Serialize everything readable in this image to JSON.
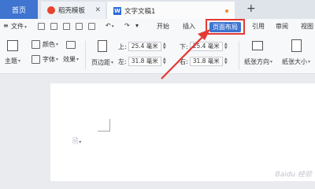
{
  "tabs": {
    "home": "首页",
    "templates": "稻壳模板",
    "document": "文字文稿1",
    "close_glyph": "✕",
    "new_tab": "+"
  },
  "menubar": {
    "file": "文件",
    "items": [
      "开始",
      "插入",
      "页面布局",
      "引用",
      "审阅",
      "视图"
    ],
    "active": "页面布局"
  },
  "toolbar": {
    "theme": "主题",
    "colors": "颜色",
    "fonts": "字体",
    "effects": "效果",
    "margins": "页边距",
    "top_label": "上:",
    "top_value": "25.4 毫米",
    "bottom_label": "下:",
    "bottom_value": "25.4 毫米",
    "left_label": "左:",
    "left_value": "31.8 毫米",
    "right_label": "右:",
    "right_value": "31.8 毫米",
    "orientation": "纸张方向",
    "size": "纸张大小"
  },
  "colors": {
    "accent": "#3f74d1",
    "highlight": "#e53935",
    "arrow": "#e53935"
  },
  "watermark": "Baidu 经验"
}
